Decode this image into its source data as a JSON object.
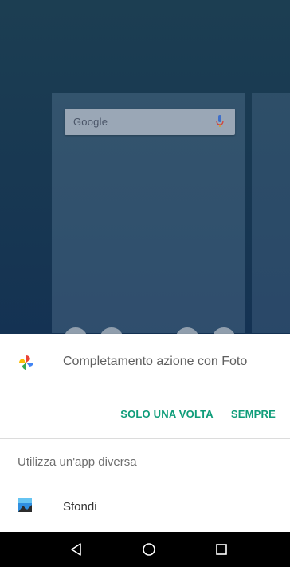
{
  "home_preview": {
    "search_bar": {
      "logo_text": "Google",
      "icon": "mic-icon"
    }
  },
  "dialog": {
    "icon": "photos-pinwheel-icon",
    "title": "Completamento azione con Foto",
    "actions": {
      "once_label": "SOLO UNA VOLTA",
      "always_label": "SEMPRE"
    },
    "section_label": "Utilizza un'app diversa",
    "apps": [
      {
        "name": "Sfondi",
        "icon": "wallpaper-app-icon"
      }
    ]
  },
  "navigation_bar": {
    "back_icon": "back-triangle-icon",
    "home_icon": "home-circle-icon",
    "recents_icon": "recents-square-icon"
  },
  "colors": {
    "accent": "#0f9d7a",
    "navbar": "#000000",
    "sheet": "#ffffff"
  }
}
